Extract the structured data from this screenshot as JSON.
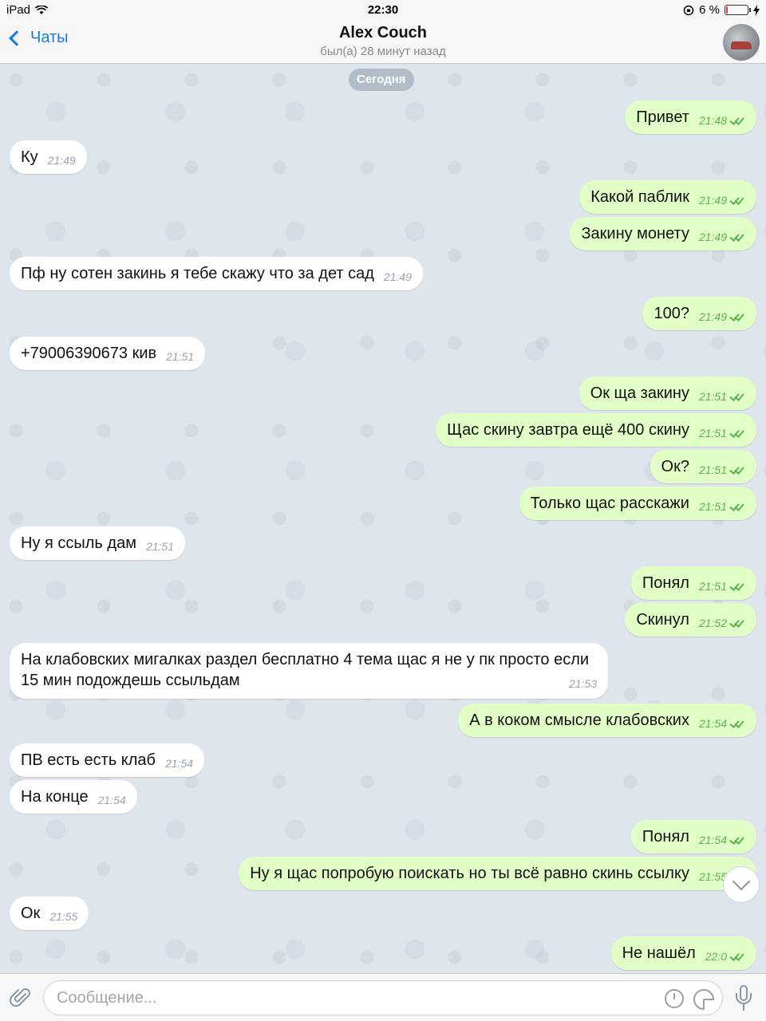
{
  "status_bar": {
    "device": "iPad",
    "time": "22:30",
    "battery_text": "6 %",
    "battery_level": 0.06
  },
  "header": {
    "back_label": "Чаты",
    "title": "Alex Couch",
    "subtitle": "был(а) 28 минут назад"
  },
  "chat": {
    "date_separator": "Сегодня",
    "messages": [
      {
        "dir": "out",
        "text": "Привет",
        "time": "21:48"
      },
      {
        "dir": "in",
        "text": "Ку",
        "time": "21:49"
      },
      {
        "dir": "out",
        "text": "Какой паблик",
        "time": "21:49"
      },
      {
        "dir": "out",
        "text": "Закину монету",
        "time": "21:49"
      },
      {
        "dir": "in",
        "text": "Пф ну сотен закинь я тебе скажу что за дет сад",
        "time": "21:49"
      },
      {
        "dir": "out",
        "text": "100?",
        "time": "21:49"
      },
      {
        "dir": "in",
        "text": "+79006390673 кив",
        "time": "21:51"
      },
      {
        "dir": "out",
        "text": "Ок ща закину",
        "time": "21:51"
      },
      {
        "dir": "out",
        "text": "Щас скину завтра ещё 400 скину",
        "time": "21:51"
      },
      {
        "dir": "out",
        "text": "Ок?",
        "time": "21:51"
      },
      {
        "dir": "out",
        "text": "Только щас расскажи",
        "time": "21:51"
      },
      {
        "dir": "in",
        "text": "Ну я ссыль дам",
        "time": "21:51"
      },
      {
        "dir": "out",
        "text": "Понял",
        "time": "21:51"
      },
      {
        "dir": "out",
        "text": "Скинул",
        "time": "21:52"
      },
      {
        "dir": "in",
        "text": "На клабовских мигалках раздел бесплатно 4 тема щас я не у пк просто если 15 мин подождешь ссыльдам",
        "time": "21:53"
      },
      {
        "dir": "out",
        "text": "А в коком смысле клабовских",
        "time": "21:54"
      },
      {
        "dir": "in",
        "text": "ПВ есть есть клаб",
        "time": "21:54"
      },
      {
        "dir": "in",
        "text": "На конце",
        "time": "21:54"
      },
      {
        "dir": "out",
        "text": "Понял",
        "time": "21:54"
      },
      {
        "dir": "out",
        "text": "Ну я щас попробую поискать но ты всё равно скинь ссылку",
        "time": "21:55"
      },
      {
        "dir": "in",
        "text": "Ок",
        "time": "21:55"
      },
      {
        "dir": "out",
        "text": "Не нашёл",
        "time": "22:0"
      }
    ]
  },
  "input": {
    "placeholder": "Сообщение..."
  },
  "icons": {
    "back": "chevron-left-icon",
    "attach": "paperclip-icon",
    "timer": "timer-icon",
    "sticker": "sticker-icon",
    "mic": "microphone-icon",
    "scroll": "chevron-down-icon"
  },
  "colors": {
    "accent": "#1a7ad6",
    "outgoing_bubble": "#e1fec6",
    "incoming_bubble": "#ffffff",
    "read_ticks": "#5db34f",
    "chat_background": "#dfe5ec"
  }
}
